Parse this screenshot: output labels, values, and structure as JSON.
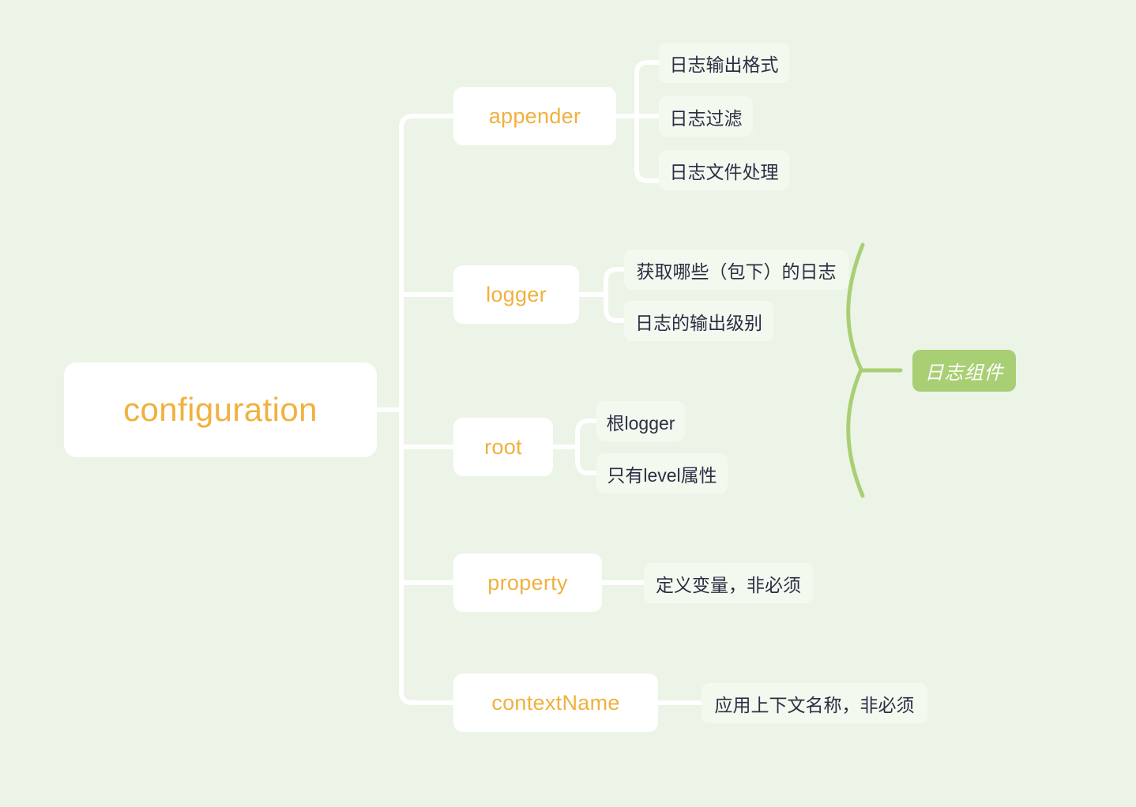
{
  "diagram": {
    "type": "mindmap",
    "title": "configuration",
    "background_color": "#ecf4e8",
    "accent_color": "#f0b13e",
    "annotation_color": "#a9cf74",
    "connector_color": "#ffffff",
    "leaf_text_color": "#2b2f43"
  },
  "root": {
    "label": "configuration"
  },
  "branches": [
    {
      "label": "appender",
      "children": [
        {
          "label": "日志输出格式"
        },
        {
          "label": "日志过滤"
        },
        {
          "label": "日志文件处理"
        }
      ]
    },
    {
      "label": "logger",
      "children": [
        {
          "label": "获取哪些（包下）的日志"
        },
        {
          "label": "日志的输出级别"
        }
      ]
    },
    {
      "label": "root",
      "children": [
        {
          "label": "根logger"
        },
        {
          "label": "只有level属性"
        }
      ]
    },
    {
      "label": "property",
      "children": [
        {
          "label": "定义变量，非必须"
        }
      ]
    },
    {
      "label": "contextName",
      "children": [
        {
          "label": "应用上下文名称，非必须"
        }
      ]
    }
  ],
  "annotations": [
    {
      "label": "日志组件",
      "groups": [
        "logger",
        "root"
      ]
    }
  ]
}
